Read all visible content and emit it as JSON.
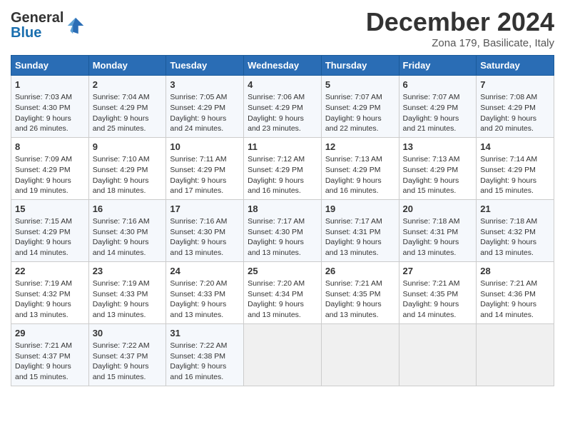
{
  "header": {
    "logo_line1": "General",
    "logo_line2": "Blue",
    "main_title": "December 2024",
    "subtitle": "Zona 179, Basilicate, Italy"
  },
  "days_of_week": [
    "Sunday",
    "Monday",
    "Tuesday",
    "Wednesday",
    "Thursday",
    "Friday",
    "Saturday"
  ],
  "weeks": [
    [
      {
        "day": "1",
        "lines": [
          "Sunrise: 7:03 AM",
          "Sunset: 4:30 PM",
          "Daylight: 9 hours",
          "and 26 minutes."
        ]
      },
      {
        "day": "2",
        "lines": [
          "Sunrise: 7:04 AM",
          "Sunset: 4:29 PM",
          "Daylight: 9 hours",
          "and 25 minutes."
        ]
      },
      {
        "day": "3",
        "lines": [
          "Sunrise: 7:05 AM",
          "Sunset: 4:29 PM",
          "Daylight: 9 hours",
          "and 24 minutes."
        ]
      },
      {
        "day": "4",
        "lines": [
          "Sunrise: 7:06 AM",
          "Sunset: 4:29 PM",
          "Daylight: 9 hours",
          "and 23 minutes."
        ]
      },
      {
        "day": "5",
        "lines": [
          "Sunrise: 7:07 AM",
          "Sunset: 4:29 PM",
          "Daylight: 9 hours",
          "and 22 minutes."
        ]
      },
      {
        "day": "6",
        "lines": [
          "Sunrise: 7:07 AM",
          "Sunset: 4:29 PM",
          "Daylight: 9 hours",
          "and 21 minutes."
        ]
      },
      {
        "day": "7",
        "lines": [
          "Sunrise: 7:08 AM",
          "Sunset: 4:29 PM",
          "Daylight: 9 hours",
          "and 20 minutes."
        ]
      }
    ],
    [
      {
        "day": "8",
        "lines": [
          "Sunrise: 7:09 AM",
          "Sunset: 4:29 PM",
          "Daylight: 9 hours",
          "and 19 minutes."
        ]
      },
      {
        "day": "9",
        "lines": [
          "Sunrise: 7:10 AM",
          "Sunset: 4:29 PM",
          "Daylight: 9 hours",
          "and 18 minutes."
        ]
      },
      {
        "day": "10",
        "lines": [
          "Sunrise: 7:11 AM",
          "Sunset: 4:29 PM",
          "Daylight: 9 hours",
          "and 17 minutes."
        ]
      },
      {
        "day": "11",
        "lines": [
          "Sunrise: 7:12 AM",
          "Sunset: 4:29 PM",
          "Daylight: 9 hours",
          "and 16 minutes."
        ]
      },
      {
        "day": "12",
        "lines": [
          "Sunrise: 7:13 AM",
          "Sunset: 4:29 PM",
          "Daylight: 9 hours",
          "and 16 minutes."
        ]
      },
      {
        "day": "13",
        "lines": [
          "Sunrise: 7:13 AM",
          "Sunset: 4:29 PM",
          "Daylight: 9 hours",
          "and 15 minutes."
        ]
      },
      {
        "day": "14",
        "lines": [
          "Sunrise: 7:14 AM",
          "Sunset: 4:29 PM",
          "Daylight: 9 hours",
          "and 15 minutes."
        ]
      }
    ],
    [
      {
        "day": "15",
        "lines": [
          "Sunrise: 7:15 AM",
          "Sunset: 4:29 PM",
          "Daylight: 9 hours",
          "and 14 minutes."
        ]
      },
      {
        "day": "16",
        "lines": [
          "Sunrise: 7:16 AM",
          "Sunset: 4:30 PM",
          "Daylight: 9 hours",
          "and 14 minutes."
        ]
      },
      {
        "day": "17",
        "lines": [
          "Sunrise: 7:16 AM",
          "Sunset: 4:30 PM",
          "Daylight: 9 hours",
          "and 13 minutes."
        ]
      },
      {
        "day": "18",
        "lines": [
          "Sunrise: 7:17 AM",
          "Sunset: 4:30 PM",
          "Daylight: 9 hours",
          "and 13 minutes."
        ]
      },
      {
        "day": "19",
        "lines": [
          "Sunrise: 7:17 AM",
          "Sunset: 4:31 PM",
          "Daylight: 9 hours",
          "and 13 minutes."
        ]
      },
      {
        "day": "20",
        "lines": [
          "Sunrise: 7:18 AM",
          "Sunset: 4:31 PM",
          "Daylight: 9 hours",
          "and 13 minutes."
        ]
      },
      {
        "day": "21",
        "lines": [
          "Sunrise: 7:18 AM",
          "Sunset: 4:32 PM",
          "Daylight: 9 hours",
          "and 13 minutes."
        ]
      }
    ],
    [
      {
        "day": "22",
        "lines": [
          "Sunrise: 7:19 AM",
          "Sunset: 4:32 PM",
          "Daylight: 9 hours",
          "and 13 minutes."
        ]
      },
      {
        "day": "23",
        "lines": [
          "Sunrise: 7:19 AM",
          "Sunset: 4:33 PM",
          "Daylight: 9 hours",
          "and 13 minutes."
        ]
      },
      {
        "day": "24",
        "lines": [
          "Sunrise: 7:20 AM",
          "Sunset: 4:33 PM",
          "Daylight: 9 hours",
          "and 13 minutes."
        ]
      },
      {
        "day": "25",
        "lines": [
          "Sunrise: 7:20 AM",
          "Sunset: 4:34 PM",
          "Daylight: 9 hours",
          "and 13 minutes."
        ]
      },
      {
        "day": "26",
        "lines": [
          "Sunrise: 7:21 AM",
          "Sunset: 4:35 PM",
          "Daylight: 9 hours",
          "and 13 minutes."
        ]
      },
      {
        "day": "27",
        "lines": [
          "Sunrise: 7:21 AM",
          "Sunset: 4:35 PM",
          "Daylight: 9 hours",
          "and 14 minutes."
        ]
      },
      {
        "day": "28",
        "lines": [
          "Sunrise: 7:21 AM",
          "Sunset: 4:36 PM",
          "Daylight: 9 hours",
          "and 14 minutes."
        ]
      }
    ],
    [
      {
        "day": "29",
        "lines": [
          "Sunrise: 7:21 AM",
          "Sunset: 4:37 PM",
          "Daylight: 9 hours",
          "and 15 minutes."
        ]
      },
      {
        "day": "30",
        "lines": [
          "Sunrise: 7:22 AM",
          "Sunset: 4:37 PM",
          "Daylight: 9 hours",
          "and 15 minutes."
        ]
      },
      {
        "day": "31",
        "lines": [
          "Sunrise: 7:22 AM",
          "Sunset: 4:38 PM",
          "Daylight: 9 hours",
          "and 16 minutes."
        ]
      },
      null,
      null,
      null,
      null
    ]
  ]
}
